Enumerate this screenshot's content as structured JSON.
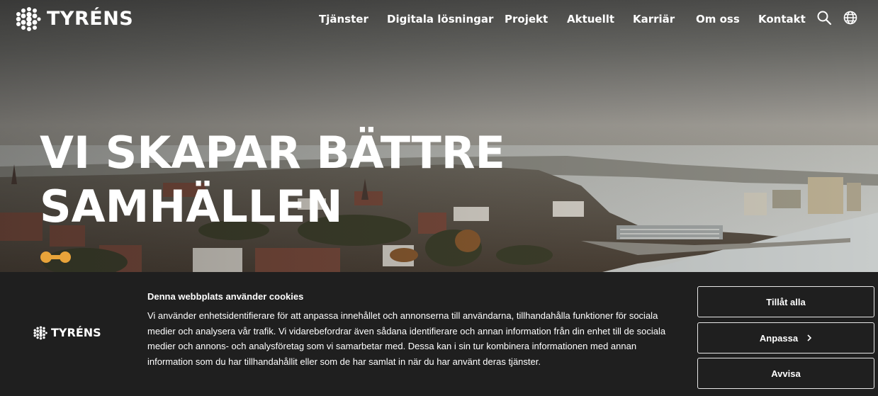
{
  "header": {
    "logo_text": "TYRÉNS",
    "nav": [
      "Tjänster",
      "Digitala lösningar",
      "Projekt",
      "Aktuellt",
      "Karriär",
      "Om oss",
      "Kontakt"
    ],
    "icons": [
      "search-icon",
      "globe-icon"
    ]
  },
  "hero": {
    "headline_line1": "VI SKAPAR BÄTTRE",
    "headline_line2": "SAMHÄLLEN"
  },
  "cookie_banner": {
    "logo_text": "TYRÉNS",
    "title": "Denna webbplats använder cookies",
    "body": "Vi använder enhetsidentifierare för att anpassa innehållet och annonserna till användarna, tillhandahålla funktioner för sociala medier och analysera vår trafik. Vi vidarebefordrar även sådana identifierare och annan information från din enhet till de sociala medier och annons- och analysföretag som vi samarbetar med. Dessa kan i sin tur kombinera informationen med annan information som du har tillhandahållit eller som de har samlat in när du har använt deras tjänster.",
    "buttons": {
      "allow_all": "Tillåt alla",
      "customize": "Anpassa",
      "decline": "Avvisa"
    }
  },
  "colors": {
    "banner_bg": "#1f1f1f",
    "accent_orange": "#e8a33a",
    "text": "#ffffff"
  }
}
